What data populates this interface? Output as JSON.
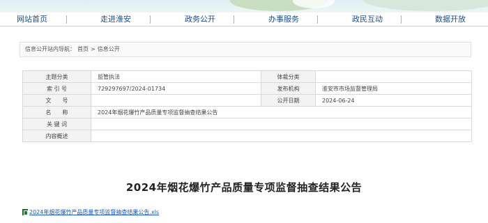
{
  "nav": {
    "items": [
      {
        "label": "网站首页"
      },
      {
        "label": "走进淮安"
      },
      {
        "label": "政务公开"
      },
      {
        "label": "办事服务"
      },
      {
        "label": "政民互动"
      },
      {
        "label": "数据开放"
      }
    ]
  },
  "breadcrumb": {
    "prefix": "信息公开站内导航：",
    "home": "首页",
    "separator": ">",
    "current": "信息公开"
  },
  "meta_table": {
    "subject_label": "主题分类",
    "subject_value": "监管执法",
    "genre_label": "体裁分类",
    "genre_value": "",
    "index_label": "索 引 号",
    "index_value": "729297697/2024-01734",
    "publisher_label": "发布机构",
    "publisher_value": "淮安市市场监督管理局",
    "docno_label": "文　　号",
    "docno_value": "",
    "date_label": "公开日期",
    "date_value": "2024-06-24",
    "name_label": "名　　称",
    "name_value": "2024年烟花爆竹产品质量专项监督抽查结果公告",
    "keywords_label": "关 键 词",
    "keywords_value": "",
    "summary_label": "内容概述",
    "summary_value": ""
  },
  "article": {
    "title": "2024年烟花爆竹产品质量专项监督抽查结果公告"
  },
  "attachment": {
    "icon": "xls-file-icon",
    "name": "2024年烟花爆竹产品质量专项监督抽查结果公告.xls"
  }
}
